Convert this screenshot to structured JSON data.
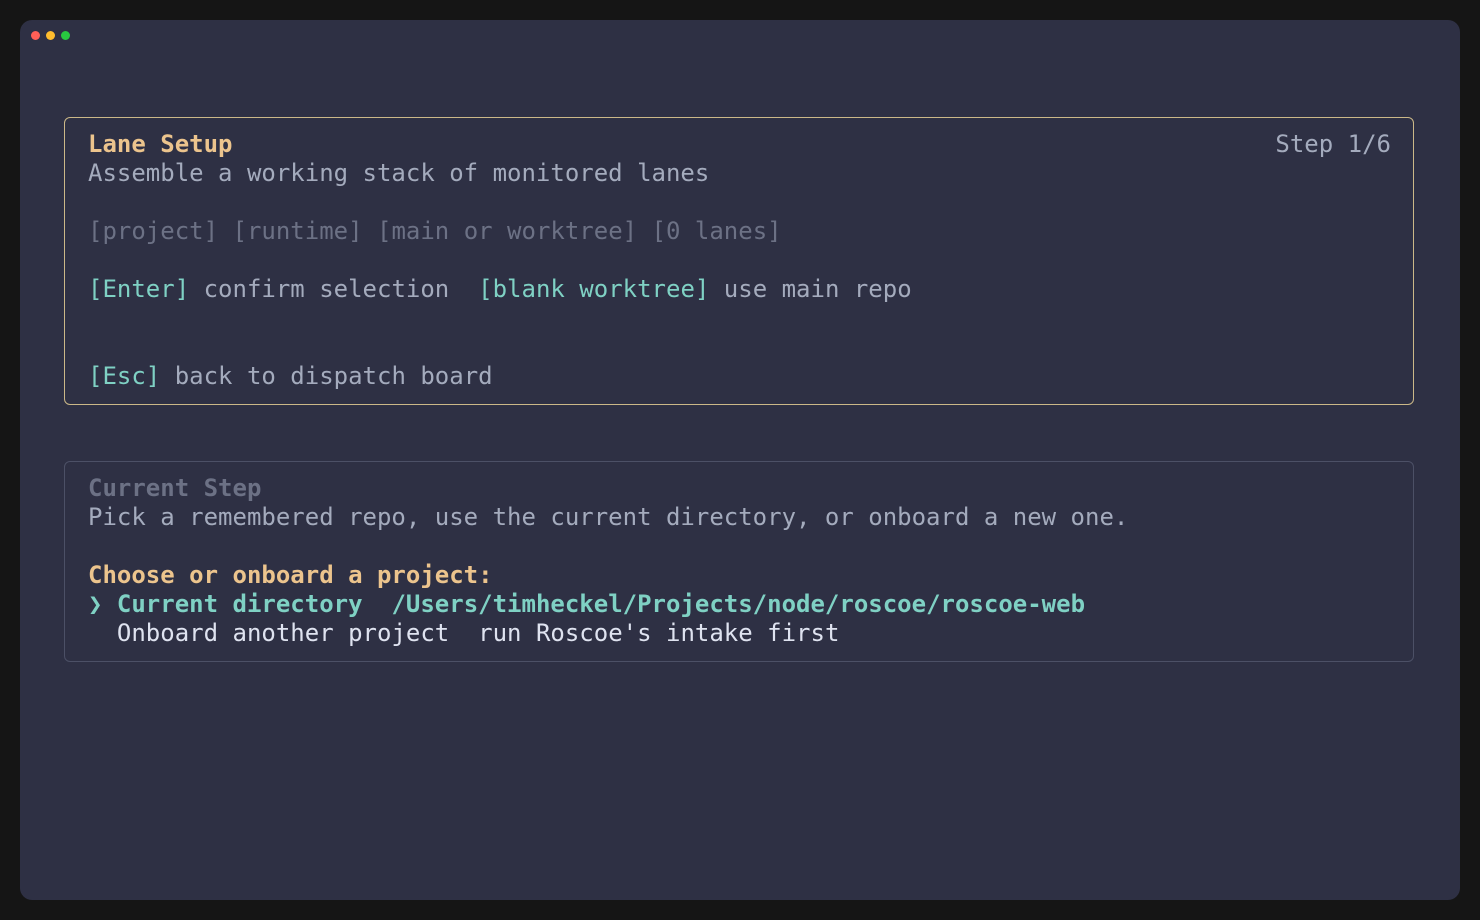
{
  "window": {
    "traffic_lights": [
      "close",
      "minimize",
      "zoom"
    ]
  },
  "setup": {
    "title": "Lane Setup",
    "step": "Step 1/6",
    "subtitle": "Assemble a working stack of monitored lanes",
    "tags": [
      "[project]",
      "[runtime]",
      "[main or worktree]",
      "[0 lanes]"
    ],
    "shortcuts": [
      {
        "key": "[Enter]",
        "label": "confirm selection"
      },
      {
        "key": "[blank worktree]",
        "label": "use main repo"
      }
    ],
    "back": {
      "key": "[Esc]",
      "label": "back to dispatch board"
    }
  },
  "current_step": {
    "title": "Current Step",
    "description": "Pick a remembered repo, use the current directory, or onboard a new one.",
    "prompt": "Choose or onboard a project:",
    "options": [
      {
        "marker": "❯",
        "label": "Current directory",
        "detail": "/Users/timheckel/Projects/node/roscoe/roscoe-web",
        "selected": true
      },
      {
        "marker": " ",
        "label": "Onboard another project",
        "detail": "run Roscoe's intake first",
        "selected": false
      }
    ]
  },
  "colors": {
    "window_bg": "#2e3044",
    "accent_title": "#ecc48d",
    "accent_key": "#7fd1c4",
    "panel_border_active": "#cbb888",
    "panel_border": "#4c5066"
  }
}
